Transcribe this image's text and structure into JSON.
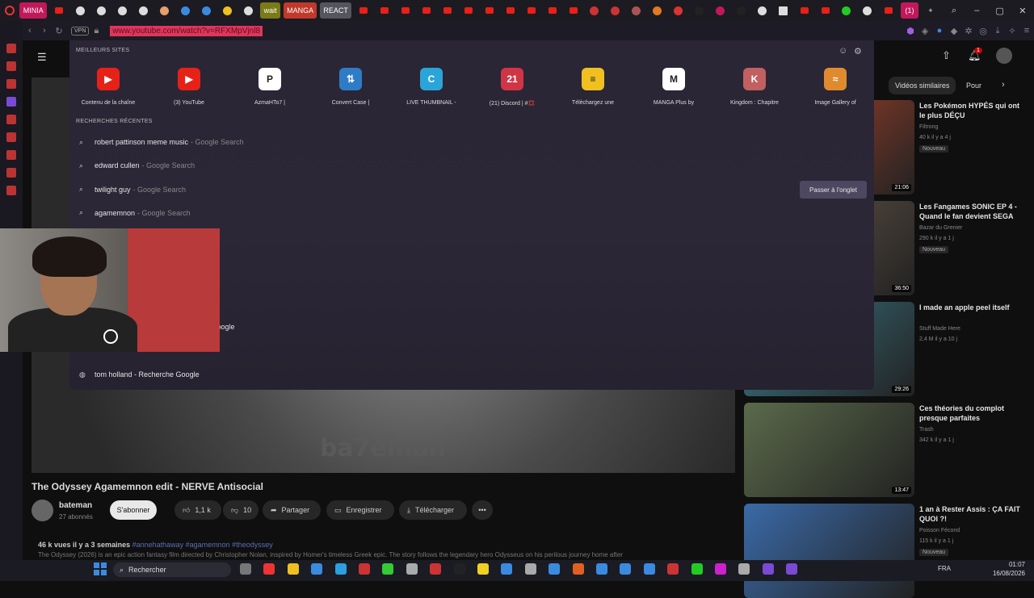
{
  "browser": {
    "tabs": [
      {
        "label": "MINIA",
        "color": "#c2185b"
      },
      {
        "label": "wait",
        "color": "#7a7a16"
      },
      {
        "label": "MANGA",
        "color": "#c0392b"
      },
      {
        "label": "REACT",
        "color": "#555560"
      },
      {
        "label": "(1)",
        "color": "#c2185b"
      }
    ],
    "vpn_label": "VPN",
    "url": "www.youtube.com/watch?v=RFXMpVjnl8"
  },
  "dropdown": {
    "top_sites_header": "MEILLEURS SITES",
    "top_sites": [
      {
        "label": "Contenu de la chaîne",
        "icon": "youtube-icon",
        "color": "#e62117",
        "glyph": "▶"
      },
      {
        "label": "(3) YouTube",
        "icon": "youtube-icon",
        "color": "#e62117",
        "glyph": "▶"
      },
      {
        "label": "AzmaHTo7 |",
        "icon": "app-icon",
        "color": "#ffffff",
        "glyph": "P"
      },
      {
        "label": "Convert Case |",
        "icon": "convert-icon",
        "color": "#2f7cc6",
        "glyph": "⇅"
      },
      {
        "label": "LIVE THUMBNAIL -",
        "icon": "canva-icon",
        "color": "#2ba5d9",
        "glyph": "C"
      },
      {
        "label": "(21) Discord | #💢",
        "icon": "discord-icon",
        "color": "#d03545",
        "glyph": "21"
      },
      {
        "label": "Téléchargez une",
        "icon": "download-site-icon",
        "color": "#f0c020",
        "glyph": "≡"
      },
      {
        "label": "MANGA Plus by",
        "icon": "manga-plus-icon",
        "color": "#ffffff",
        "glyph": "M"
      },
      {
        "label": "Kingdom : Chapitre",
        "icon": "kingdom-icon",
        "color": "#c06060",
        "glyph": "K"
      },
      {
        "label": "Image Gallery of",
        "icon": "gallery-icon",
        "color": "#e08a30",
        "glyph": "≈"
      }
    ],
    "recent_header": "RECHERCHES RÉCENTES",
    "recent": [
      {
        "query": "robert pattinson meme music",
        "source": "- Google Search",
        "icon": "search-icon"
      },
      {
        "query": "edward cullen",
        "source": "- Google Search",
        "icon": "search-icon"
      },
      {
        "query": "twilight guy",
        "source": "- Google Search",
        "icon": "search-icon"
      },
      {
        "query": "agamemnon",
        "source": "- Google Search",
        "icon": "search-icon"
      }
    ],
    "history": [
      {
        "query": "e Google",
        "icon": "globe-icon"
      },
      {
        "query": "tom holland - Recherche Google",
        "icon": "globe-icon"
      }
    ],
    "switch_tab_label": "Passer à l'onglet"
  },
  "youtube": {
    "chips": [
      "Vidéos similaires",
      "Pour"
    ],
    "bell_count": "1",
    "video_watermark": "ba7eman",
    "video_title": "The Odyssey Agamemnon edit - NERVE Antisocial",
    "channel": {
      "name": "bateman",
      "subs": "27 abonnés"
    },
    "subscribe_label": "S'abonner",
    "actions": {
      "likes": "1,1 k",
      "dislikes": "10",
      "share": "Partager",
      "save": "Enregistrer",
      "download": "Télécharger"
    },
    "description_meta": "46 k vues  il y a 3 semaines",
    "description_tags": "#annehathaway #agamemnon #theodyssey",
    "description_text": "The Odyssey (2026) is an epic action fantasy film directed by Christopher Nolan, inspired by Homer's timeless Greek epic. The story follows the legendary hero Odysseus on his perilous journey home after",
    "related": [
      {
        "title": "Les Pokémon HYPÉS qui ont le plus DÉÇU",
        "channel": "Filtrong",
        "meta": "40 k  il y a 4 j",
        "new": "Nouveau",
        "duration": "21:06",
        "thumb_color": "#b8452a"
      },
      {
        "title": "Les Fangames SONIC EP 4 - Quand le fan devient SEGA",
        "channel": "Bazar du Grenier",
        "meta": "290 k  il y a 1 j",
        "new": "Nouveau",
        "duration": "36:50",
        "thumb_color": "#6a5a4a"
      },
      {
        "title": "I made an apple peel itself",
        "channel": "Stuff Made Here",
        "meta": "2,4 M  il y a 10 j",
        "new": "",
        "duration": "29:26",
        "thumb_color": "#3a7a8a"
      },
      {
        "title": "Ces théories du complot presque parfaites",
        "channel": "Trash",
        "meta": "342 k  il y a 1 j",
        "new": "",
        "duration": "13:47",
        "thumb_color": "#5a6a4a"
      },
      {
        "title": "1 an à Rester Assis : ÇA FAIT QUOI ?!",
        "channel": "Poisson Fécond",
        "meta": "115 k  il y a 1 j",
        "new": "Nouveau",
        "duration": "",
        "thumb_color": "#3a6aa8"
      }
    ]
  },
  "taskbar": {
    "search_label": "Rechercher",
    "language": "FRA",
    "time": "01:07",
    "date": "16/08/2026"
  }
}
